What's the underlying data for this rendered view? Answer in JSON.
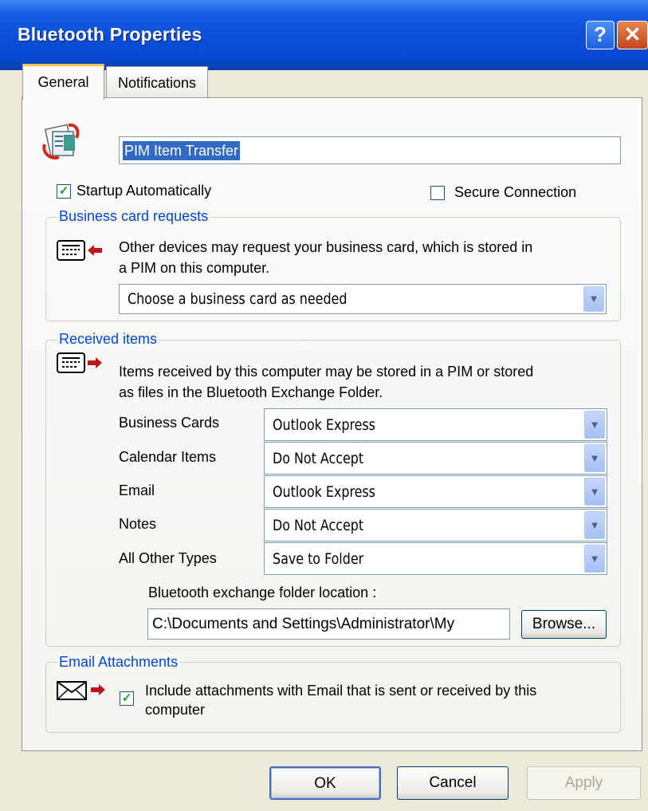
{
  "window": {
    "title": "Bluetooth Properties",
    "help_glyph": "?",
    "close_glyph": "✕"
  },
  "tabs": [
    {
      "label": "General"
    },
    {
      "label": "Notifications"
    }
  ],
  "service_name": {
    "value": "PIM Item Transfer"
  },
  "options": {
    "startup_label": "Startup Automatically",
    "startup_checked": true,
    "secure_label": "Secure Connection",
    "secure_checked": false
  },
  "business_card": {
    "legend": "Business card requests",
    "desc_line1": "Other devices may request your business card, which is stored in",
    "desc_line2": "a PIM on this computer.",
    "select": "Choose a business card as needed"
  },
  "received": {
    "legend": "Received items",
    "desc_line1": "Items received by this computer may be stored in a PIM or stored",
    "desc_line2": "as files in the Bluetooth Exchange Folder.",
    "rows": [
      {
        "label": "Business Cards",
        "value": "Outlook Express"
      },
      {
        "label": "Calendar Items",
        "value": "Do Not Accept"
      },
      {
        "label": "Email",
        "value": "Outlook Express"
      },
      {
        "label": "Notes",
        "value": "Do Not Accept"
      },
      {
        "label": "All Other Types",
        "value": "Save to Folder"
      }
    ],
    "folder_label": "Bluetooth exchange folder location :",
    "folder_value": "C:\\Documents and Settings\\Administrator\\My",
    "browse": "Browse..."
  },
  "email": {
    "legend": "Email Attachments",
    "check_label_line1": "Include attachments with Email that is sent or received by this",
    "check_label_line2": "computer",
    "checked": true
  },
  "buttons": {
    "ok": "OK",
    "cancel": "Cancel",
    "apply": "Apply"
  }
}
